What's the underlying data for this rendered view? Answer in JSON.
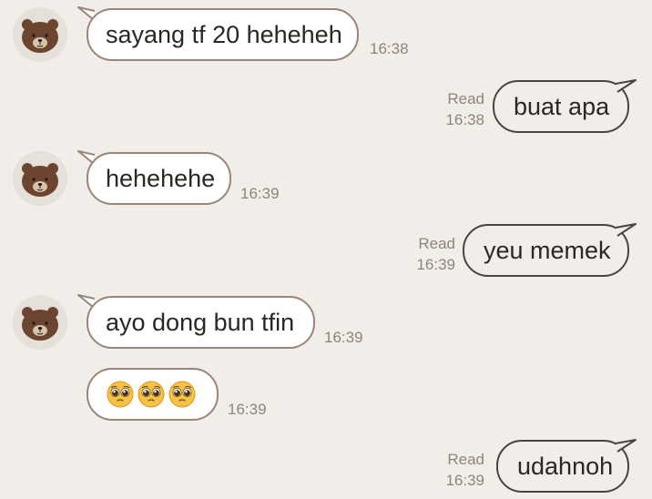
{
  "colors": {
    "background": "#f1ede8",
    "incoming_bubble": "#ffffff",
    "incoming_border": "#9a8578",
    "outgoing_border": "#4a4440",
    "meta_text": "#8f847a"
  },
  "messages": [
    {
      "direction": "incoming",
      "text": "sayang tf 20 heheheh",
      "time": "16:38"
    },
    {
      "direction": "outgoing",
      "text": "buat apa",
      "status": "Read",
      "time": "16:38"
    },
    {
      "direction": "incoming",
      "text": "hehehehe",
      "time": "16:39"
    },
    {
      "direction": "outgoing",
      "text": "yeu memek",
      "status": "Read",
      "time": "16:39"
    },
    {
      "direction": "incoming",
      "text": "ayo dong bun tfin",
      "time": "16:39"
    },
    {
      "direction": "incoming",
      "emoji": [
        "pleading-face",
        "pleading-face",
        "pleading-face"
      ],
      "time": "16:39"
    },
    {
      "direction": "outgoing",
      "text": "udahnoh",
      "status": "Read",
      "time": "16:39"
    }
  ]
}
